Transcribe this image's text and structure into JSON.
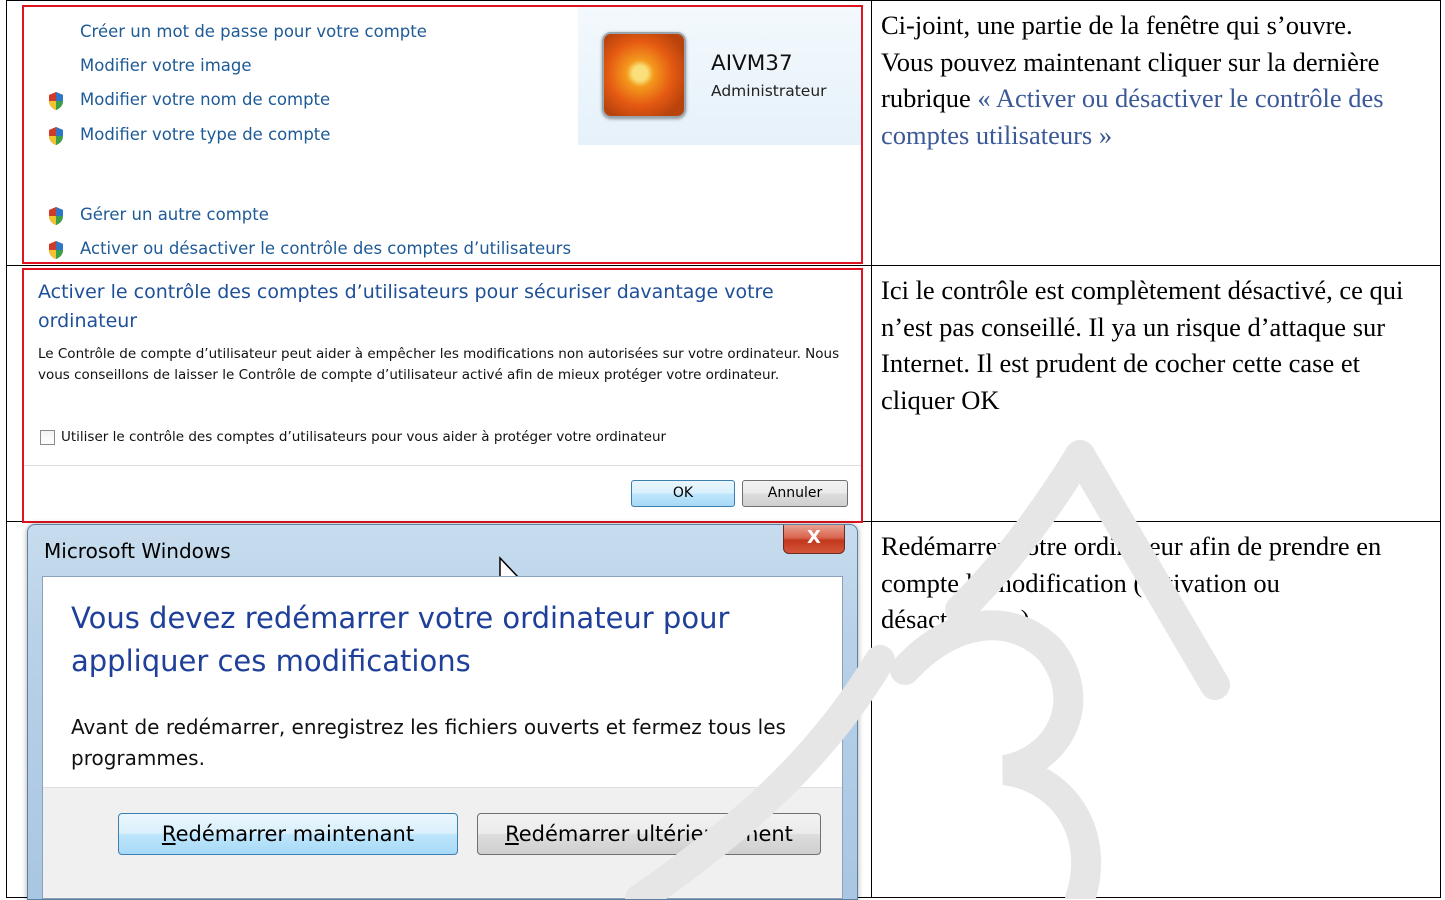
{
  "row1": {
    "links": [
      {
        "label": "Créer un mot de passe pour votre compte",
        "shield": false
      },
      {
        "label": "Modifier votre image",
        "shield": false
      },
      {
        "label": "Modifier votre nom de compte",
        "shield": true
      },
      {
        "label": "Modifier votre type de compte",
        "shield": true
      },
      {
        "label": "Gérer un autre compte",
        "shield": true
      },
      {
        "label": "Activer ou désactiver le contrôle des comptes d’utilisateurs",
        "shield": true
      }
    ],
    "account": {
      "name": "AIVM37",
      "role": "Administrateur"
    },
    "note": {
      "line1": "Ci-joint, une partie de la fenêtre qui s’ouvre.",
      "line2": "Vous pouvez maintenant cliquer sur la dernière rubrique ",
      "link": "« Activer ou désactiver le contrôle des comptes utilisateurs »"
    }
  },
  "row2": {
    "title": "Activer le contrôle des comptes d’utilisateurs pour sécuriser davantage votre ordinateur",
    "description": "Le Contrôle de compte d’utilisateur peut aider à empêcher les modifications non autorisées sur votre ordinateur. Nous vous conseillons de laisser le Contrôle de compte d’utilisateur activé afin de mieux protéger votre ordinateur.",
    "checkbox_label": "Utiliser le contrôle des comptes d’utilisateurs pour vous aider à protéger votre ordinateur",
    "checked": false,
    "ok_label": "OK",
    "cancel_label": "Annuler",
    "note": "Ici le contrôle est complètement désactivé, ce qui n’est pas conseillé. Il ya un risque d’attaque sur Internet. Il est prudent de cocher cette case et cliquer OK"
  },
  "row3": {
    "window_title": "Microsoft Windows",
    "close_glyph": "X",
    "instruction": "Vous devez redémarrer votre ordinateur pour appliquer ces modifications",
    "body": "Avant de redémarrer, enregistrez les fichiers ouverts et fermez tous les programmes.",
    "restart_now": {
      "mnemonic": "R",
      "rest": "edémarrer maintenant"
    },
    "restart_later": {
      "mnemonic": "R",
      "rest": "edémarrer ultérieurement"
    },
    "note": "Redémarrer votre ordinateur afin de prendre en compte la modification (activation ou désactivation)"
  },
  "watermark": {
    "text": "AIVM37",
    "color": "#e6e6e6"
  }
}
